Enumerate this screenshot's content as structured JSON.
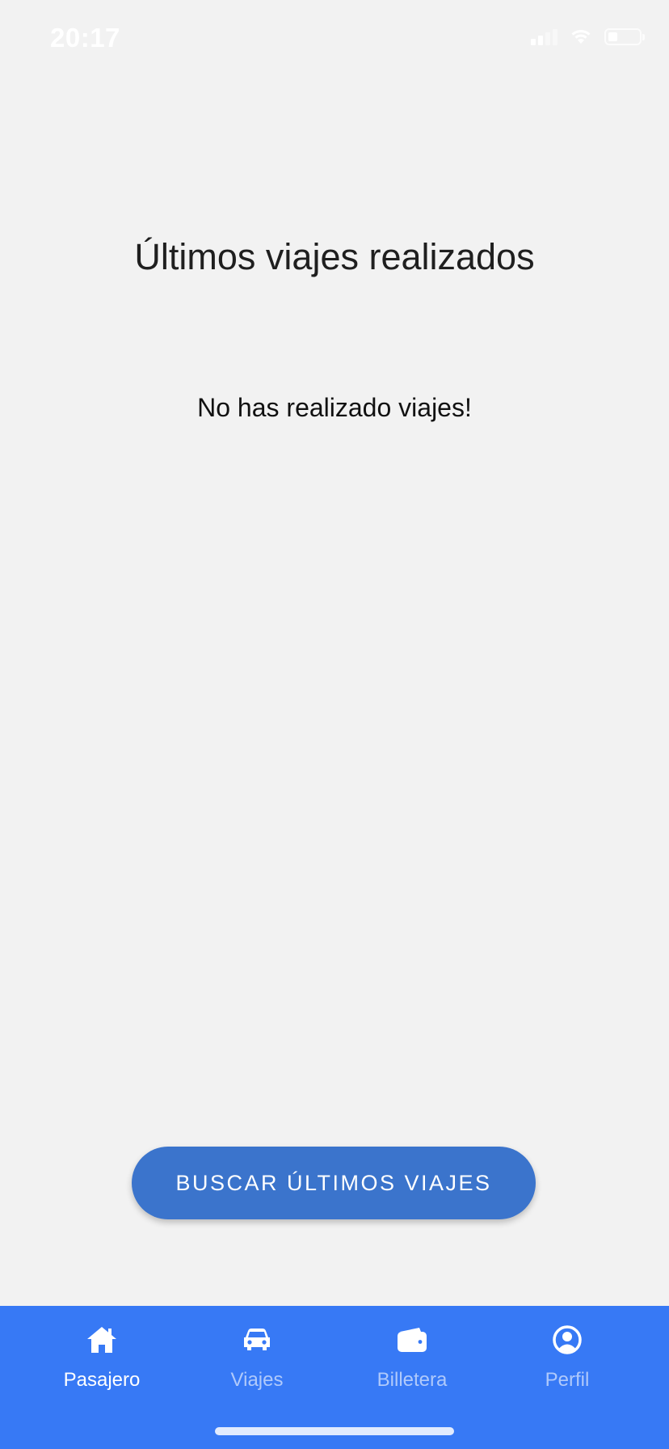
{
  "status_bar": {
    "time": "20:17"
  },
  "main": {
    "title": "Últimos viajes realizados",
    "empty_message": "No has realizado viajes!",
    "search_button_label": "BUSCAR ÚLTIMOS VIAJES"
  },
  "bottom_nav": {
    "items": [
      {
        "label": "Pasajero",
        "icon": "home-icon",
        "active": true
      },
      {
        "label": "Viajes",
        "icon": "car-icon",
        "active": false
      },
      {
        "label": "Billetera",
        "icon": "wallet-icon",
        "active": false
      },
      {
        "label": "Perfil",
        "icon": "profile-icon",
        "active": false
      }
    ]
  },
  "colors": {
    "background": "#f2f2f2",
    "nav_background": "#3779f5",
    "button_background": "#3b74cc",
    "title_text": "#1f1f1f"
  }
}
